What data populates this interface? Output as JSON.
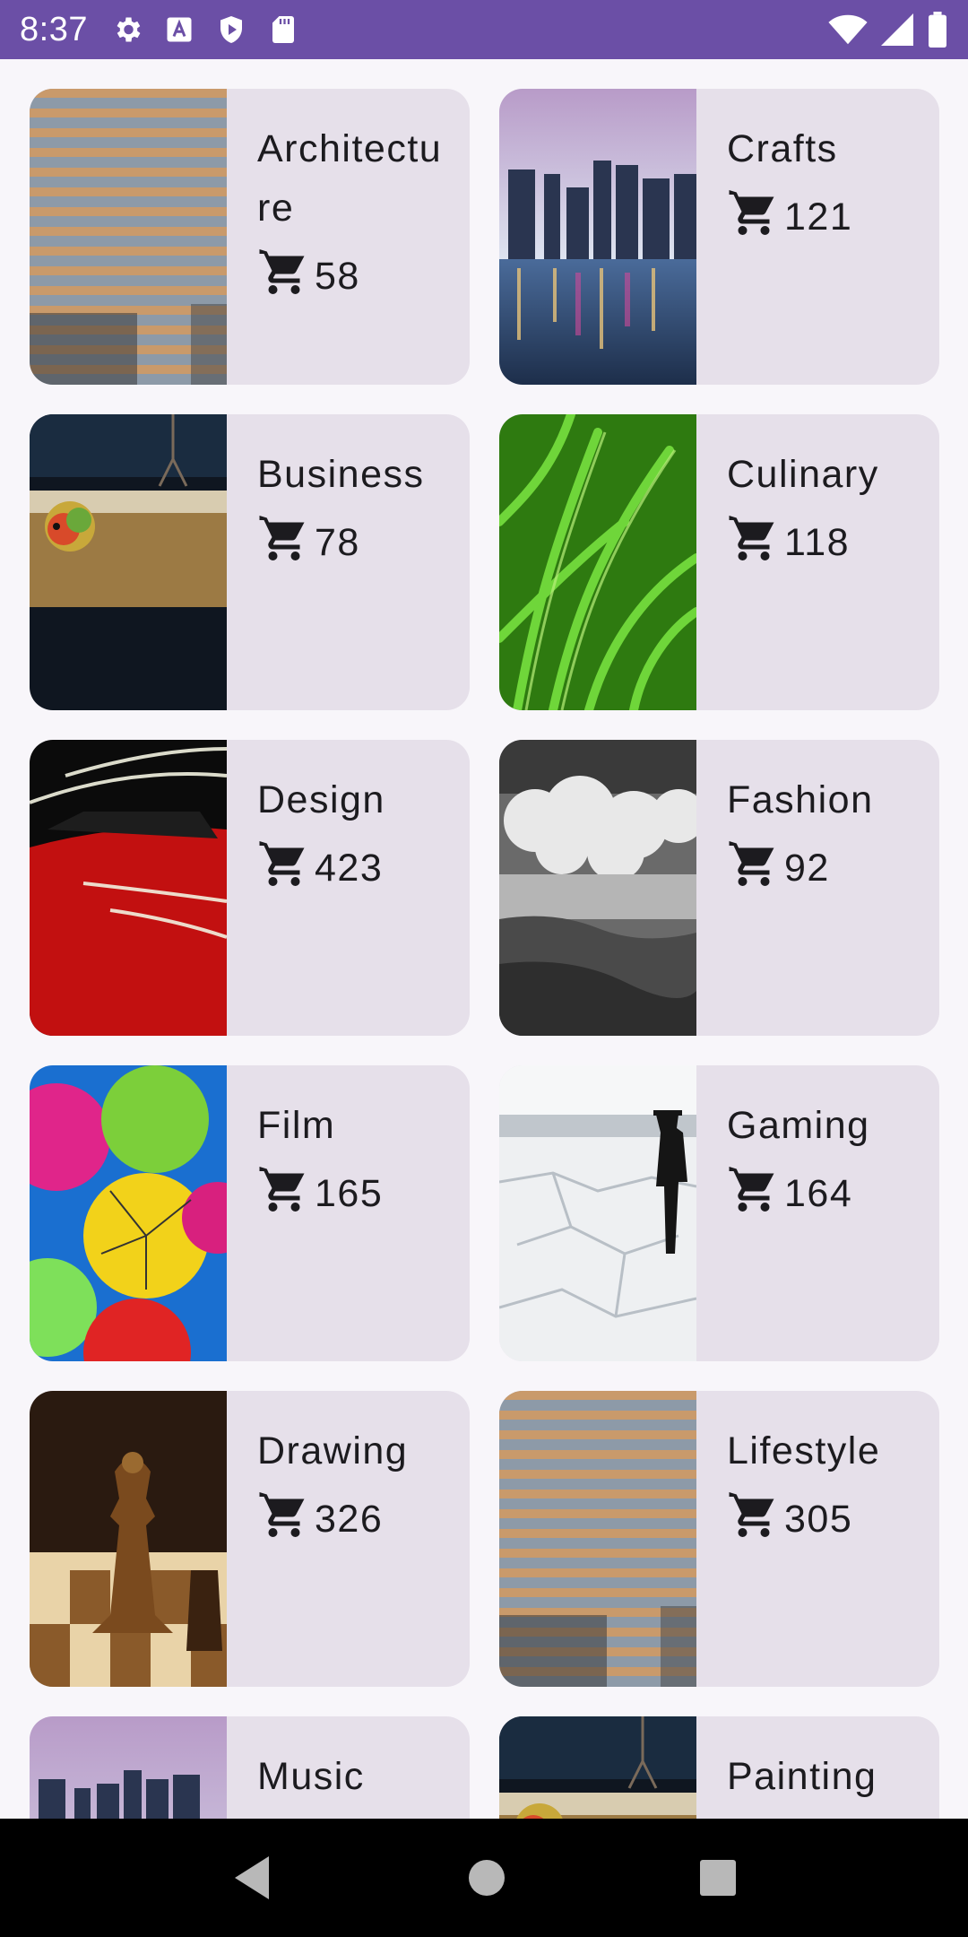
{
  "status_bar": {
    "time": "8:37",
    "left_icons": [
      "gear-icon",
      "a-icon",
      "play-shield-icon",
      "sd-card-icon"
    ],
    "right_icons": [
      "wifi-icon",
      "signal-icon",
      "battery-icon"
    ]
  },
  "topics": [
    {
      "name": "Architecture",
      "count": "58",
      "image": "building-facade"
    },
    {
      "name": "Crafts",
      "count": "121",
      "image": "city-skyline"
    },
    {
      "name": "Business",
      "count": "78",
      "image": "lovebird"
    },
    {
      "name": "Culinary",
      "count": "118",
      "image": "grass"
    },
    {
      "name": "Design",
      "count": "423",
      "image": "red-car"
    },
    {
      "name": "Fashion",
      "count": "92",
      "image": "clouds-canyon"
    },
    {
      "name": "Film",
      "count": "165",
      "image": "umbrellas"
    },
    {
      "name": "Gaming",
      "count": "164",
      "image": "salt-flat-person"
    },
    {
      "name": "Drawing",
      "count": "326",
      "image": "chess"
    },
    {
      "name": "Lifestyle",
      "count": "305",
      "image": "building-facade"
    },
    {
      "name": "Music",
      "count": "",
      "image": "city-skyline"
    },
    {
      "name": "Painting",
      "count": "",
      "image": "lovebird"
    }
  ],
  "nav_bar": {
    "icons": [
      "back-icon",
      "home-icon",
      "recents-icon"
    ]
  },
  "colors": {
    "status_bar": "#6b4fa6",
    "card": "#e6e0ea",
    "background": "#f8f6fa"
  }
}
